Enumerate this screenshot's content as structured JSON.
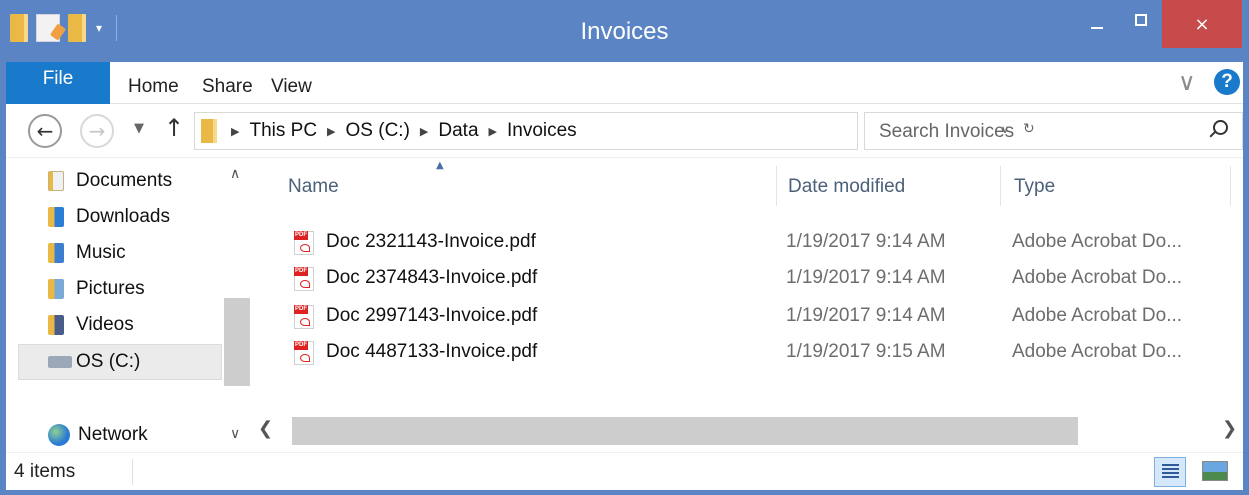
{
  "window": {
    "title": "Invoices",
    "close_glyph": "×"
  },
  "ribbon": {
    "file": "File",
    "tabs": [
      "Home",
      "Share",
      "View"
    ],
    "help": "?"
  },
  "nav": {
    "breadcrumbs": [
      "This PC",
      "OS (C:)",
      "Data",
      "Invoices"
    ],
    "search_placeholder": "Search Invoices"
  },
  "sidebar": {
    "items": [
      {
        "label": "Documents",
        "icon": "documents-folder-icon"
      },
      {
        "label": "Downloads",
        "icon": "downloads-folder-icon"
      },
      {
        "label": "Music",
        "icon": "music-folder-icon"
      },
      {
        "label": "Pictures",
        "icon": "pictures-folder-icon"
      },
      {
        "label": "Videos",
        "icon": "videos-folder-icon"
      },
      {
        "label": "OS (C:)",
        "icon": "drive-icon",
        "selected": true
      },
      {
        "label": "Network",
        "icon": "network-icon"
      }
    ]
  },
  "files": {
    "columns": [
      "Name",
      "Date modified",
      "Type"
    ],
    "rows": [
      {
        "name": "Doc 2321143-Invoice.pdf",
        "date": "1/19/2017 9:14 AM",
        "type": "Adobe Acrobat Do..."
      },
      {
        "name": "Doc 2374843-Invoice.pdf",
        "date": "1/19/2017 9:14 AM",
        "type": "Adobe Acrobat Do..."
      },
      {
        "name": "Doc 2997143-Invoice.pdf",
        "date": "1/19/2017 9:14 AM",
        "type": "Adobe Acrobat Do..."
      },
      {
        "name": "Doc 4487133-Invoice.pdf",
        "date": "1/19/2017 9:15 AM",
        "type": "Adobe Acrobat Do..."
      }
    ]
  },
  "status": {
    "count": "4 items"
  },
  "colors": {
    "titlebar": "#5b84c4",
    "file_tab": "#1979ca",
    "close_button": "#c74b4b"
  }
}
